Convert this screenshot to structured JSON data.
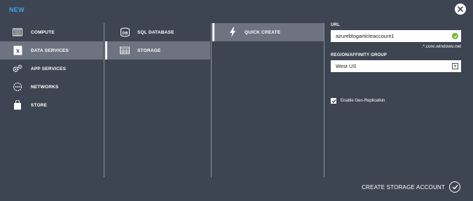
{
  "dialog": {
    "title": "NEW"
  },
  "column1": {
    "items": [
      {
        "label": "COMPUTE",
        "icon": "compute-icon"
      },
      {
        "label": "DATA SERVICES",
        "icon": "data-services-icon"
      },
      {
        "label": "APP SERVICES",
        "icon": "app-services-icon"
      },
      {
        "label": "NETWORKS",
        "icon": "networks-icon"
      },
      {
        "label": "STORE",
        "icon": "store-icon"
      }
    ],
    "selected": "DATA SERVICES"
  },
  "column2": {
    "items": [
      {
        "label": "SQL DATABASE",
        "icon": "sql-database-icon",
        "icon_text": "DB"
      },
      {
        "label": "STORAGE",
        "icon": "storage-icon"
      }
    ],
    "selected": "STORAGE"
  },
  "column3": {
    "items": [
      {
        "label": "QUICK CREATE",
        "icon": "lightning-icon"
      }
    ],
    "selected": "QUICK CREATE"
  },
  "form": {
    "url_label": "URL",
    "url_value": "azureblogarticleaccount1",
    "url_suffix": ".*.core.windows.net",
    "region_label": "REGION/AFFINITY GROUP",
    "region_value": "West US",
    "geo_label": "Enable Geo-Replication",
    "geo_checked": true
  },
  "footer": {
    "create_label": "CREATE STORAGE ACCOUNT"
  },
  "colors": {
    "background": "#3e4552",
    "selected_row": "#6d7380",
    "title_accent": "#3ea3dc",
    "valid_green": "#6cba2e"
  }
}
